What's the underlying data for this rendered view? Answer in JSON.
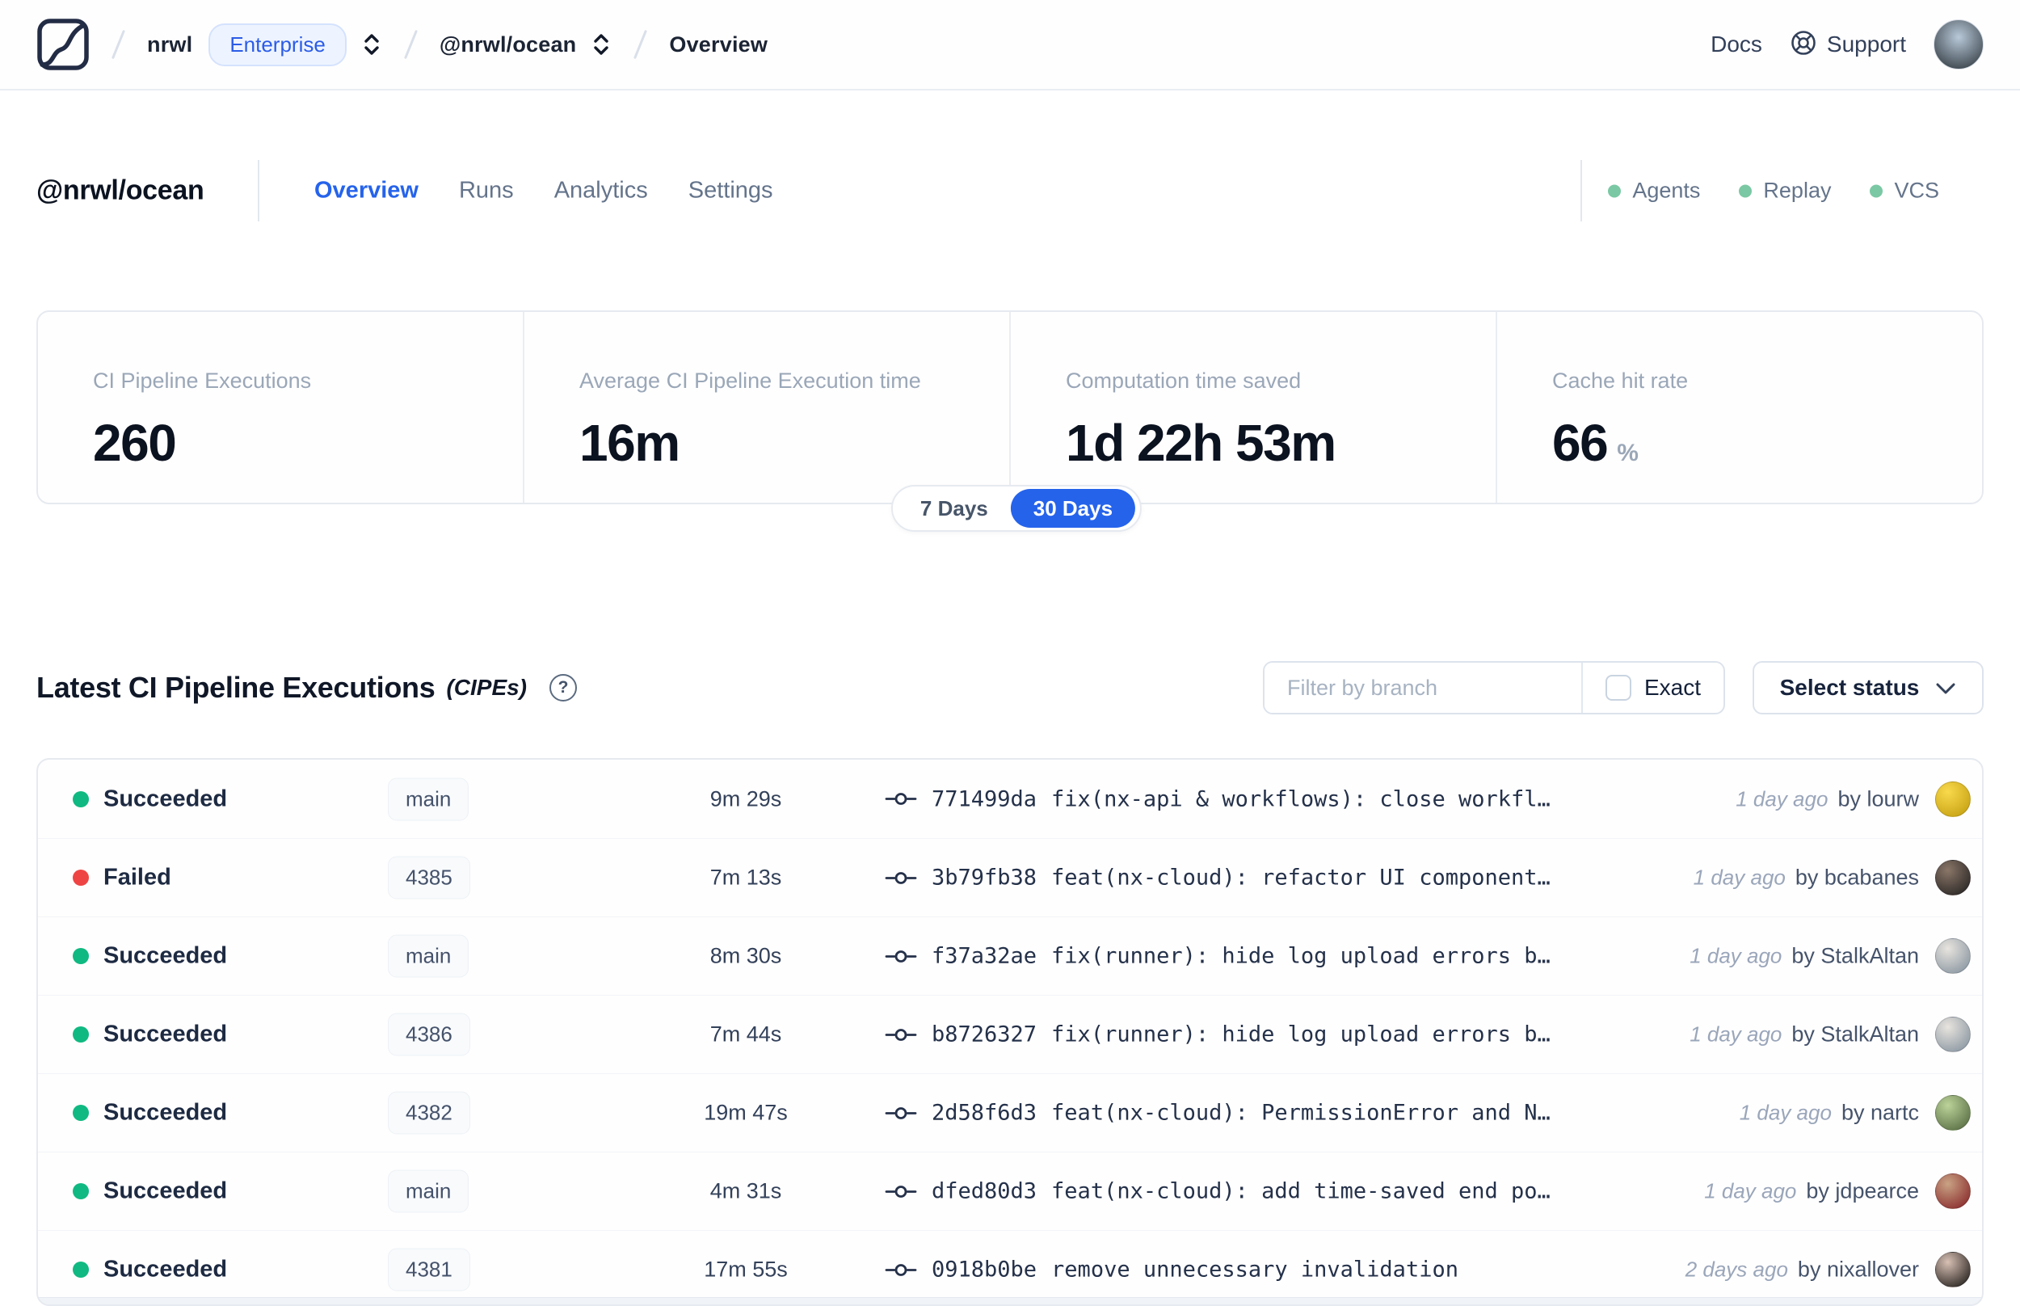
{
  "colors": {
    "accent_blue": "#2563eb",
    "succeeded_green": "#10b981",
    "failed_red": "#ef4444",
    "indicator_green": "#7bc8a4"
  },
  "header": {
    "breadcrumb": {
      "org": "nrwl",
      "org_badge": "Enterprise",
      "workspace": "@nrwl/ocean",
      "page": "Overview"
    },
    "docs": "Docs",
    "support": "Support",
    "avatar": {
      "c1": "#b9c9d9",
      "c2": "#434d55"
    }
  },
  "workspace": {
    "title": "@nrwl/ocean",
    "tabs": [
      {
        "label": "Overview",
        "active": true
      },
      {
        "label": "Runs",
        "active": false
      },
      {
        "label": "Analytics",
        "active": false
      },
      {
        "label": "Settings",
        "active": false
      }
    ],
    "indicators": [
      {
        "label": "Agents",
        "status": "online"
      },
      {
        "label": "Replay",
        "status": "online"
      },
      {
        "label": "VCS",
        "status": "online"
      }
    ]
  },
  "stats": [
    {
      "label": "CI Pipeline Executions",
      "value": "260",
      "suffix": ""
    },
    {
      "label": "Average CI Pipeline Execution time",
      "value": "16m",
      "suffix": ""
    },
    {
      "label": "Computation time saved",
      "value": "1d 22h 53m",
      "suffix": ""
    },
    {
      "label": "Cache hit rate",
      "value": "66",
      "suffix": "%"
    }
  ],
  "range_toggle": {
    "options": [
      "7 Days",
      "30 Days"
    ],
    "selected": "30 Days"
  },
  "cipes": {
    "title": "Latest CI Pipeline Executions",
    "title_suffix": "(CIPEs)",
    "filter": {
      "placeholder": "Filter by branch",
      "exact_label": "Exact",
      "exact_checked": false
    },
    "status_select_label": "Select status",
    "rows": [
      {
        "status": "Succeeded",
        "status_color": "#10b981",
        "branch": "main",
        "duration": "9m 29s",
        "commit_hash": "771499da",
        "commit_message": "fix(nx-api & workflows): close workfl…",
        "time_ago": "1 day ago",
        "author": "by lourw",
        "avatar": {
          "c1": "#f9d94d",
          "c2": "#c8a414"
        }
      },
      {
        "status": "Failed",
        "status_color": "#ef4444",
        "branch": "4385",
        "duration": "7m 13s",
        "commit_hash": "3b79fb38",
        "commit_message": "feat(nx-cloud): refactor UI component…",
        "time_ago": "1 day ago",
        "author": "by bcabanes",
        "avatar": {
          "c1": "#8a7668",
          "c2": "#2e2a28"
        }
      },
      {
        "status": "Succeeded",
        "status_color": "#10b981",
        "branch": "main",
        "duration": "8m 30s",
        "commit_hash": "f37a32ae",
        "commit_message": "fix(runner): hide log upload errors b…",
        "time_ago": "1 day ago",
        "author": "by StalkAltan",
        "avatar": {
          "c1": "#e8e4de",
          "c2": "#8e9aa4"
        }
      },
      {
        "status": "Succeeded",
        "status_color": "#10b981",
        "branch": "4386",
        "duration": "7m 44s",
        "commit_hash": "b8726327",
        "commit_message": "fix(runner): hide log upload errors b…",
        "time_ago": "1 day ago",
        "author": "by StalkAltan",
        "avatar": {
          "c1": "#e8e4de",
          "c2": "#8e9aa4"
        }
      },
      {
        "status": "Succeeded",
        "status_color": "#10b981",
        "branch": "4382",
        "duration": "19m 47s",
        "commit_hash": "2d58f6d3",
        "commit_message": "feat(nx-cloud): PermissionError and N…",
        "time_ago": "1 day ago",
        "author": "by nartc",
        "avatar": {
          "c1": "#bcd39a",
          "c2": "#5d7247"
        }
      },
      {
        "status": "Succeeded",
        "status_color": "#10b981",
        "branch": "main",
        "duration": "4m 31s",
        "commit_hash": "dfed80d3",
        "commit_message": "feat(nx-cloud): add time-saved end po…",
        "time_ago": "1 day ago",
        "author": "by jdpearce",
        "avatar": {
          "c1": "#c9a384",
          "c2": "#8c3030"
        }
      },
      {
        "status": "Succeeded",
        "status_color": "#10b981",
        "branch": "4381",
        "duration": "17m 55s",
        "commit_hash": "0918b0be",
        "commit_message": "remove unnecessary invalidation",
        "time_ago": "2 days ago",
        "author": "by nixallover",
        "avatar": {
          "c1": "#d8c0b4",
          "c2": "#2f2a26"
        }
      }
    ]
  }
}
